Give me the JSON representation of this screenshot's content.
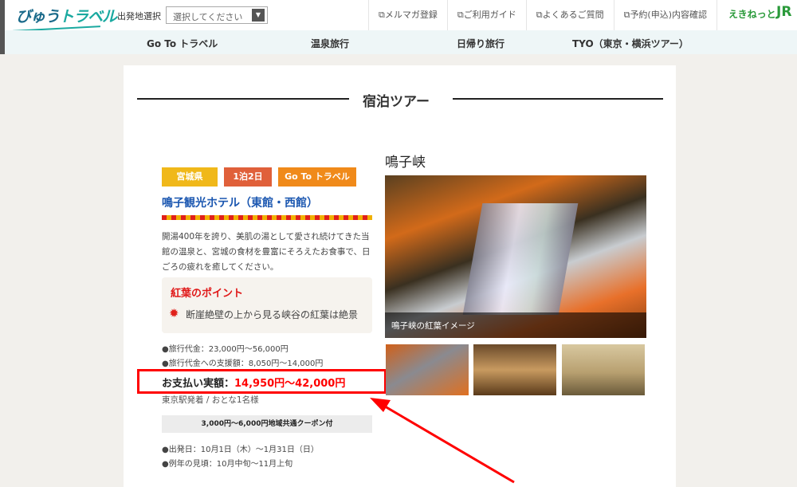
{
  "header": {
    "logo_a": "びゅう",
    "logo_b": "トラベル",
    "departure_label": "出発地選択",
    "departure_select": "選択してください",
    "links": [
      "メルマガ登録",
      "ご利用ガイド",
      "よくあるご質問",
      "予約(申込)内容確認"
    ],
    "ekinet": "えきねっと",
    "jr": "JR"
  },
  "nav": [
    "Go To トラベル",
    "温泉旅行",
    "日帰り旅行",
    "TYO（東京・横浜ツアー）"
  ],
  "section_title": "宿泊ツアー",
  "tour": {
    "tags": [
      "宮城県",
      "1泊2日",
      "Go To トラベル"
    ],
    "hotel": "鳴子観光ホテル（東館・西館）",
    "description": "開湯400年を誇り、美肌の湯として愛され続けてきた当館の温泉と、宮城の食材を豊富にそろえたお食事で、日ごろの疲れを癒してください。",
    "point_title": "紅葉のポイント",
    "point_text": "断崖絶壁の上から見る峡谷の紅葉は絶景",
    "price": "●旅行代金：23,000円〜56,000円",
    "subsidy": "●旅行代金への支援額：8,050円〜14,000円",
    "pay_label": "お支払い実額：",
    "pay_value": "14,950円〜42,000円",
    "from": "東京駅発着 / おとな1名様",
    "coupon": "3,000円〜6,000円地域共通クーポン付",
    "departure": "●出発日：10月1日（木）〜1月31日（日）",
    "season": "●例年の見頃：10月中旬〜11月上旬"
  },
  "gallery": {
    "place": "鳴子峡",
    "caption": "鳴子峡の紅葉イメージ"
  },
  "colors": {
    "tag1": "#f0b81a",
    "tag2": "#e0603a",
    "tag3": "#f08a1a",
    "highlight": "#ff0000"
  }
}
